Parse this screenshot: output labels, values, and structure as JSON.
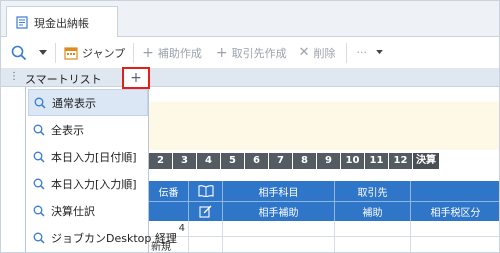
{
  "tab": {
    "title": "現金出納帳",
    "icon": "ledger-icon"
  },
  "toolbar": {
    "search_icon": "search-icon",
    "dropdown_icon": "caret-down-icon",
    "jump_label": "ジャンプ",
    "jump_icon": "calendar-icon",
    "aux_create_label": "補助作成",
    "partner_create_label": "取引先作成",
    "delete_label": "削除",
    "more_label": "···"
  },
  "smartlist": {
    "title": "スマートリスト",
    "add_label": "+",
    "items": [
      {
        "label": "通常表示",
        "selected": true
      },
      {
        "label": "全表示",
        "selected": false
      },
      {
        "label": "本日入力[日付順]",
        "selected": false
      },
      {
        "label": "本日入力[入力順]",
        "selected": false
      },
      {
        "label": "決算仕訳",
        "selected": false
      },
      {
        "label": "ジョブカンDesktop 経理",
        "selected": false
      }
    ]
  },
  "months": [
    "2",
    "3",
    "4",
    "5",
    "6",
    "7",
    "8",
    "9",
    "10",
    "11",
    "12"
  ],
  "settlement_label": "決算",
  "grid": {
    "row1": [
      "伝番",
      "",
      "相手科目",
      "取引先",
      ""
    ],
    "row2": [
      "",
      "",
      "相手補助",
      "補助",
      "相手税区分"
    ]
  },
  "data": {
    "number": "4",
    "new_label": "新規"
  },
  "colors": {
    "header_blue": "#2f76c9",
    "highlight_red": "#e0201b",
    "month_dark": "#555b63"
  }
}
